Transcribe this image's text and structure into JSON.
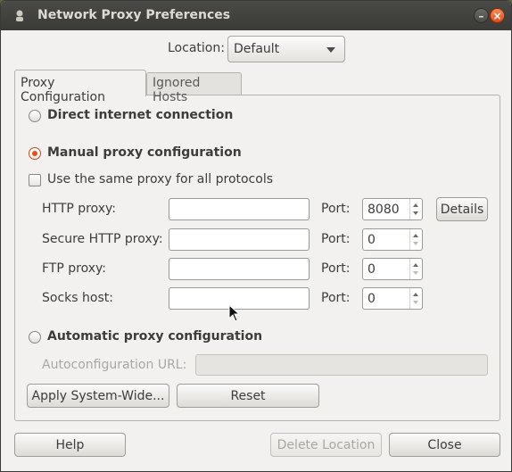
{
  "window": {
    "title": "Network Proxy Preferences"
  },
  "location": {
    "label": "Location:",
    "value": "Default"
  },
  "tabs": [
    {
      "label": "Proxy Configuration",
      "active": true
    },
    {
      "label": "Ignored Hosts",
      "active": false
    }
  ],
  "options": {
    "direct": "Direct internet connection",
    "manual": "Manual proxy configuration",
    "same_proxy": "Use the same proxy for all protocols",
    "automatic": "Automatic proxy configuration",
    "selected": "manual"
  },
  "proxies": [
    {
      "label": "HTTP proxy:",
      "host": "",
      "port_label": "Port:",
      "port": "8080"
    },
    {
      "label": "Secure HTTP proxy:",
      "host": "",
      "port_label": "Port:",
      "port": "0"
    },
    {
      "label": "FTP proxy:",
      "host": "",
      "port_label": "Port:",
      "port": "0"
    },
    {
      "label": "Socks host:",
      "host": "",
      "port_label": "Port:",
      "port": "0"
    }
  ],
  "details_button": "Details",
  "autoconfig": {
    "label": "Autoconfiguration URL:",
    "value": ""
  },
  "buttons": {
    "apply": "Apply System-Wide...",
    "reset": "Reset",
    "help": "Help",
    "delete_location": "Delete Location",
    "close": "Close"
  }
}
